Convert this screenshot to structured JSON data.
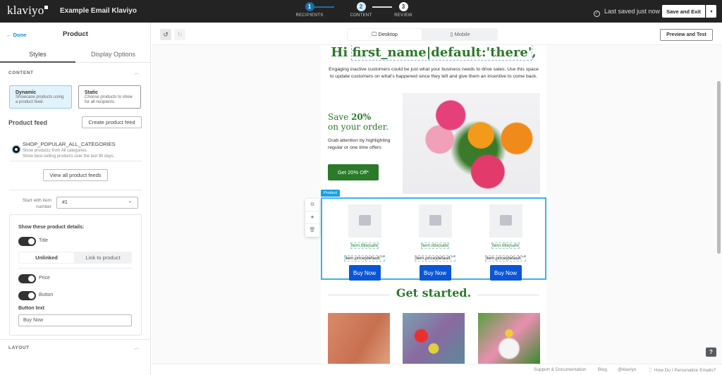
{
  "topbar": {
    "logo": "klaviyo",
    "doc_title": "Example Email Klaviyo",
    "steps": [
      {
        "num": "1",
        "label": "RECIPIENTS"
      },
      {
        "num": "2",
        "label": "CONTENT"
      },
      {
        "num": "3",
        "label": "REVIEW"
      }
    ],
    "saved_status": "Last saved just now",
    "save_exit_label": "Save and Exit",
    "save_dropdown_icon": "▾"
  },
  "sidebar": {
    "done_label": "← Done",
    "title": "Product",
    "tabs": [
      {
        "label": "Styles"
      },
      {
        "label": "Display Options"
      }
    ],
    "content_heading": "CONTENT",
    "cards": [
      {
        "title": "Dynamic",
        "desc": "Showcase products using a product feed."
      },
      {
        "title": "Static",
        "desc": "Choose products to show for all recipients."
      }
    ],
    "product_feed_label": "Product feed",
    "create_feed_label": "Create product feed",
    "feed": {
      "name": "SHOP_POPULAR_ALL_CATEGORIES",
      "desc1": "Show products from All categories.",
      "desc2": "Show best-selling products over the last 90 days."
    },
    "view_feeds_label": "View all product feeds",
    "start_item_label": "Start with item number",
    "start_item_value": "#1",
    "details_heading": "Show these product details:",
    "toggles": [
      {
        "label": "Title",
        "on": true
      },
      {
        "label": "Price",
        "on": true
      },
      {
        "label": "Button",
        "on": true
      }
    ],
    "link_options": [
      "Unlinked",
      "Link to product"
    ],
    "button_text_label": "Button text",
    "button_text_value": "Buy Now",
    "layout_heading": "LAYOUT"
  },
  "toolbar": {
    "undo_icon": "↺",
    "redo_icon": "↻",
    "desktop_label": "Desktop",
    "mobile_label": "Mobile",
    "preview_label": "Preview and Test"
  },
  "email": {
    "greeting_prefix": "Hi ",
    "greeting_var": "first_name|default:'there'",
    "greeting_suffix": ",",
    "intro": "Engaging inactive customers could be just what your business needs to drive sales. Use this space to update customers on what's happened since they left and give them an incentive to come back.",
    "save_line1_a": "Save ",
    "save_line1_b": "20%",
    "save_line2": "on your order.",
    "grab": "Grab attention by highlighting regular or one time offers",
    "cta": "Get 20% Off*",
    "product_tag": "Product",
    "products": [
      {
        "title": "item.title|safe",
        "price": "item.price|default:\"\"",
        "button": "Buy Now"
      },
      {
        "title": "item.title|safe",
        "price": "item.price|default:\"\"",
        "button": "Buy Now"
      },
      {
        "title": "item.title|safe",
        "price": "item.price|default:\"\"",
        "button": "Buy Now"
      }
    ],
    "get_started": "Get started."
  },
  "footer": {
    "links": [
      "Support & Documentation",
      "Blog",
      "@klaviyo",
      "❔ How Do I Personalize Emails?"
    ],
    "help_icon": "?"
  }
}
